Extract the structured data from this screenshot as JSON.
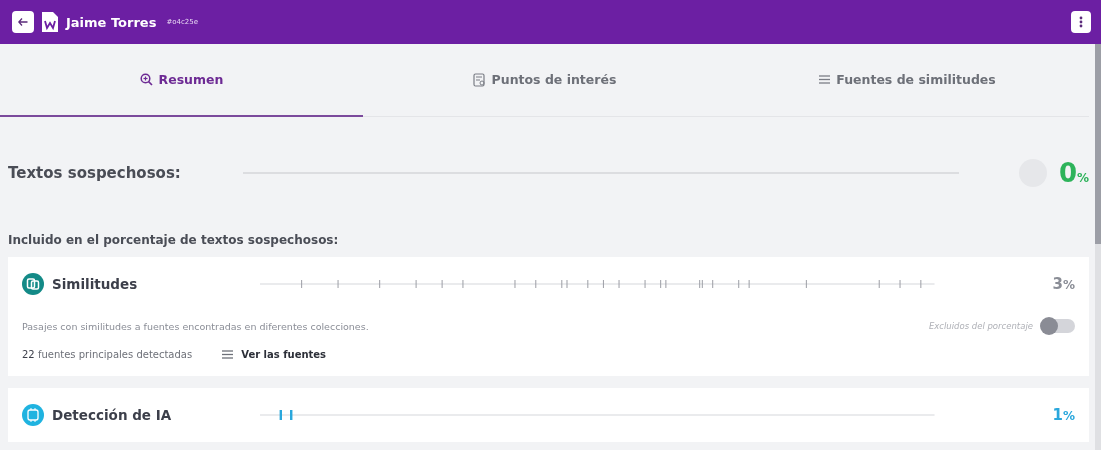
{
  "header": {
    "title": "Jaime Torres",
    "doc_id": "#o4c25e"
  },
  "tabs": [
    {
      "label": "Resumen",
      "kind": "search",
      "selected": true
    },
    {
      "label": "Puntos de interés",
      "kind": "doc",
      "selected": false
    },
    {
      "label": "Fuentes de similitudes",
      "kind": "list",
      "selected": false
    }
  ],
  "suspicious": {
    "label": "Textos sospechosos:",
    "value": "0",
    "unit": "%"
  },
  "included_label": "Incluido en el porcentaje de textos sospechosos:",
  "sections": [
    {
      "kind": "similarity",
      "title": "Similitudes",
      "color": "#138a87",
      "value": "3",
      "unit": "%",
      "description": "Pasajes con similitudes a fuentes encontradas en diferentes colecciones.",
      "toggle_label": "Excluidos del porcentaje",
      "on": false,
      "count": "22",
      "count_label": "fuentes principales detectadas",
      "link": "Ver las fuentes"
    },
    {
      "kind": "ai",
      "title": "Detección de IA",
      "color": "#1fb3e0",
      "value": "1",
      "unit": "%"
    }
  ]
}
